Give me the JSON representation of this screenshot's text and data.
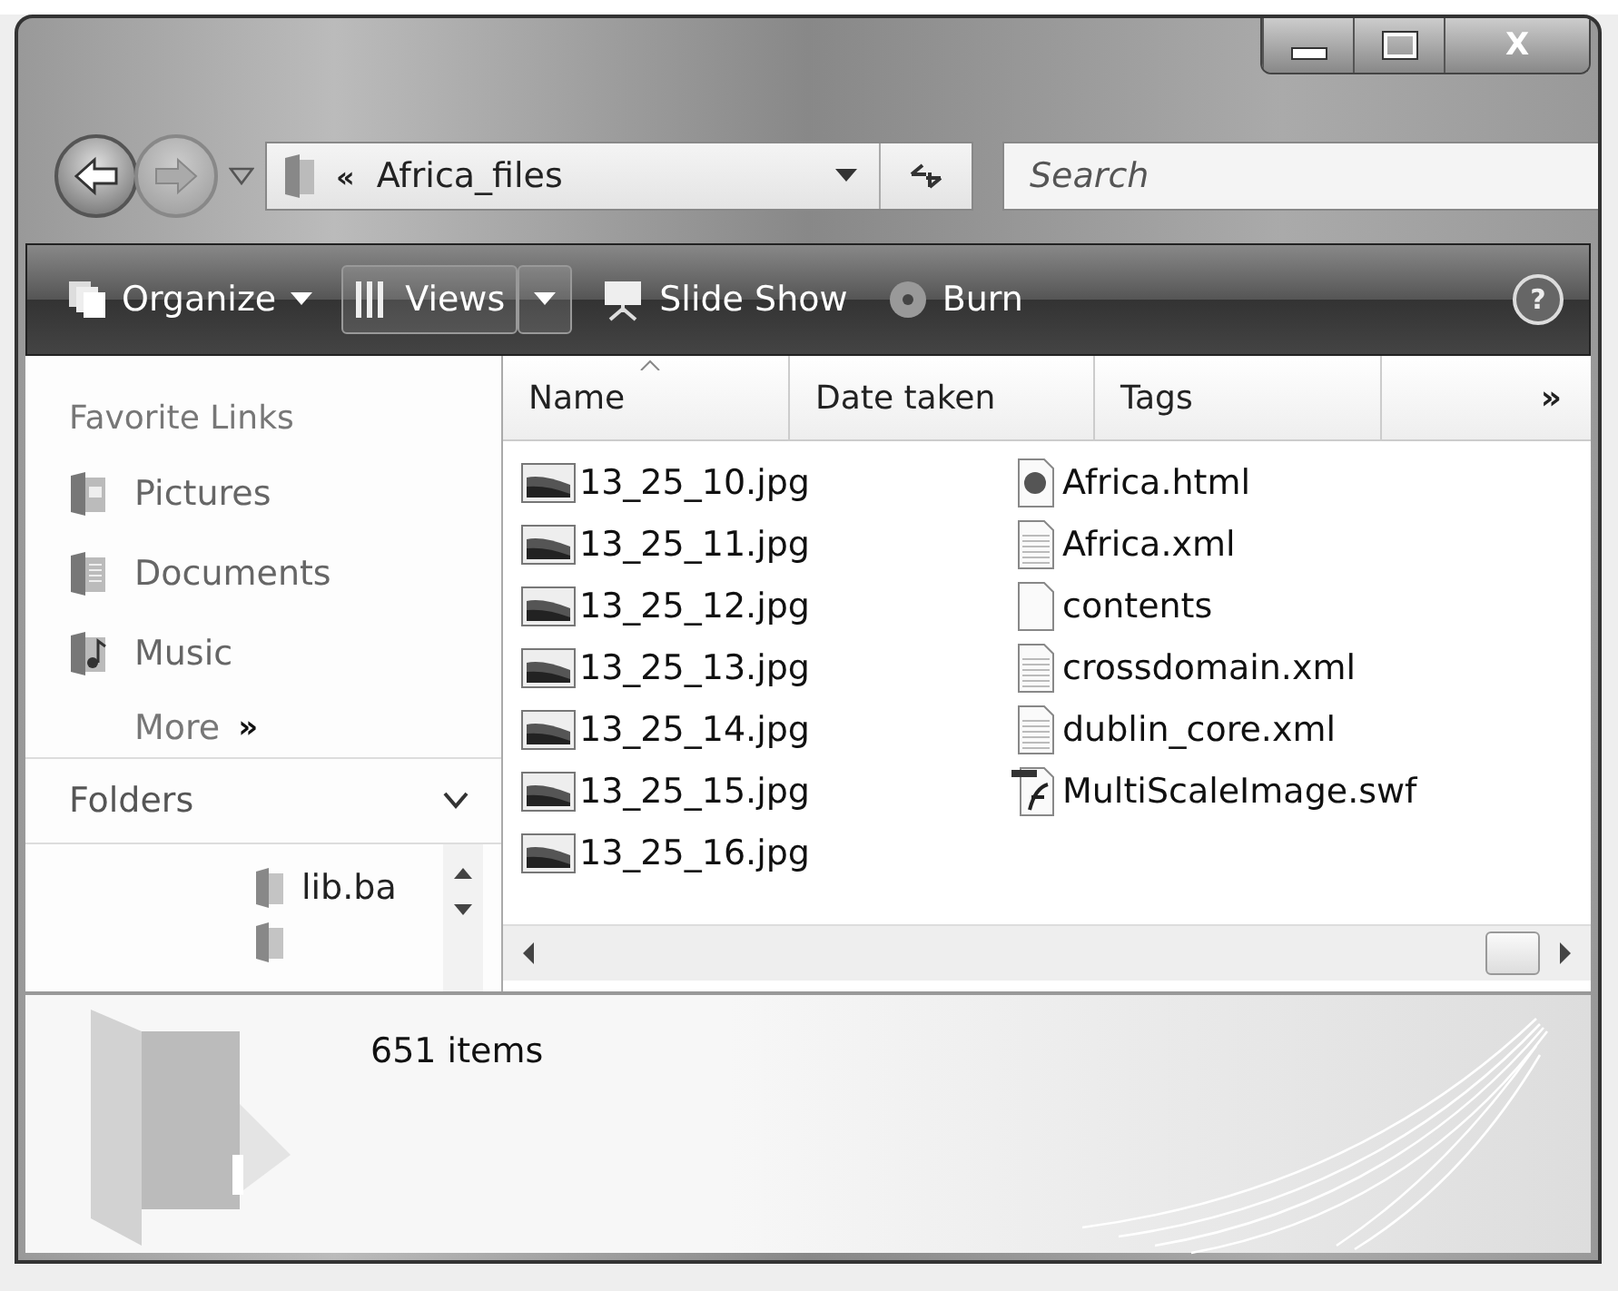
{
  "caption_buttons": [
    {
      "kind": "minimize"
    },
    {
      "kind": "maximize"
    },
    {
      "kind": "close",
      "label": "X"
    }
  ],
  "address": {
    "chevron": "«",
    "path": "Africa_files"
  },
  "search": {
    "placeholder": "Search"
  },
  "toolbar": [
    {
      "label": "Organize",
      "kind": "menu"
    },
    {
      "label": "Views",
      "kind": "split"
    },
    {
      "label": "Slide Show",
      "kind": "slideshow"
    },
    {
      "label": "Burn",
      "kind": "burn"
    }
  ],
  "help": "?",
  "sidebar": {
    "title": "Favorite Links",
    "links": [
      {
        "label": "Pictures",
        "kind": "pictures"
      },
      {
        "label": "Documents",
        "kind": "documents"
      },
      {
        "label": "Music",
        "kind": "music"
      }
    ],
    "more": {
      "label": "More",
      "icon": "»"
    },
    "folders": {
      "label": "Folders",
      "expanded": true,
      "items": [
        {
          "label": "lib.ba"
        }
      ]
    }
  },
  "columns": [
    {
      "label": "Name",
      "sorted": true
    },
    {
      "label": "Date taken",
      "sorted": false
    },
    {
      "label": "Tags",
      "sorted": false
    }
  ],
  "columns_more": "»",
  "files": [
    {
      "name": "13_25_10.jpg",
      "kind": "image"
    },
    {
      "name": "13_25_11.jpg",
      "kind": "image"
    },
    {
      "name": "13_25_12.jpg",
      "kind": "image"
    },
    {
      "name": "13_25_13.jpg",
      "kind": "image"
    },
    {
      "name": "13_25_14.jpg",
      "kind": "image"
    },
    {
      "name": "13_25_15.jpg",
      "kind": "image"
    },
    {
      "name": "13_25_16.jpg",
      "kind": "image"
    },
    {
      "name": "Africa.html",
      "kind": "html"
    },
    {
      "name": "Africa.xml",
      "kind": "text"
    },
    {
      "name": "contents",
      "kind": "blank"
    },
    {
      "name": "crossdomain.xml",
      "kind": "text"
    },
    {
      "name": "dublin_core.xml",
      "kind": "text"
    },
    {
      "name": "MultiScaleImage.swf",
      "kind": "flash"
    }
  ],
  "details": {
    "count": "651 items"
  }
}
